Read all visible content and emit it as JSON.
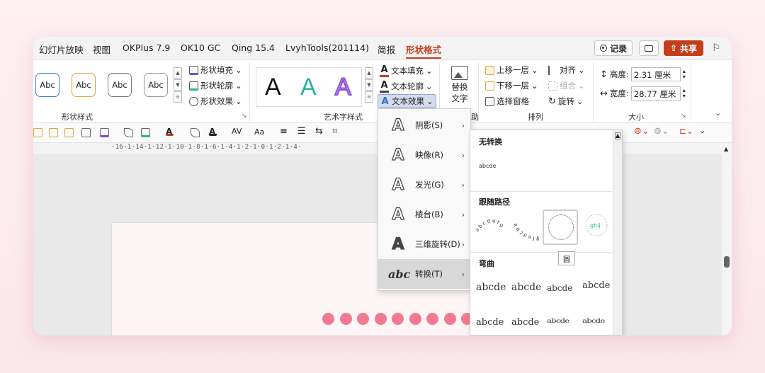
{
  "tabs": [
    "幻灯片放映",
    "视图",
    "OKPlus 7.9",
    "OK10 GC",
    "Qing 15.4",
    "LvyhTools(201114)",
    "简报",
    "形状格式"
  ],
  "active_tab": "形状格式",
  "top_buttons": {
    "record": "记录",
    "share": "共享"
  },
  "groups": {
    "shape_styles": {
      "label": "形状样式",
      "abc": [
        "Abc",
        "Abc",
        "Abc",
        "Abc"
      ],
      "fill": "形状填充",
      "outline": "形状轮廓",
      "effects": "形状效果"
    },
    "wordart": {
      "label": "艺术字样式",
      "letters": [
        "A",
        "A",
        "A"
      ],
      "fill": "文本填充",
      "outline": "文本轮廓",
      "effects": "文本效果"
    },
    "alt_text": {
      "label_line1": "替换",
      "label_line2": "文字",
      "group_tail": "助"
    },
    "arrange": {
      "label": "排列",
      "forward": "上移一层",
      "backward": "下移一层",
      "pane": "选择窗格",
      "align": "对齐",
      "group": "组合",
      "rotate": "旋转"
    },
    "size": {
      "label": "大小",
      "height_label": "高度:",
      "height": "2.31 厘米",
      "width_label": "宽度:",
      "width": "28.77 厘米"
    }
  },
  "ruler": "·16·1·14·1·12·1·10·1·8·1·6·1·4·1·2·1·0·1·2·1·4·",
  "text_effects_menu": [
    {
      "label": "阴影(S)",
      "icon": "A"
    },
    {
      "label": "映像(R)",
      "icon": "A"
    },
    {
      "label": "发光(G)",
      "icon": "A"
    },
    {
      "label": "棱台(B)",
      "icon": "A"
    },
    {
      "label": "三维旋转(D)",
      "icon": "A"
    },
    {
      "label": "转换(T)",
      "icon": "abc"
    }
  ],
  "transform_panel": {
    "no_transform": "无转换",
    "no_transform_sample": "abcde",
    "follow_path": "跟随路径",
    "warp": "弯曲",
    "warp_samples": [
      "abcde",
      "abcde",
      "abcde",
      "abcde",
      "abcde",
      "abcde",
      "abcde",
      "abcde"
    ],
    "tooltip": "圆"
  },
  "colors": {
    "accent": "#c43e1c",
    "dots": "#f07a90",
    "teal": "#2bb39a",
    "purple": "#8a4fd8"
  },
  "slide_dot_count": 9
}
